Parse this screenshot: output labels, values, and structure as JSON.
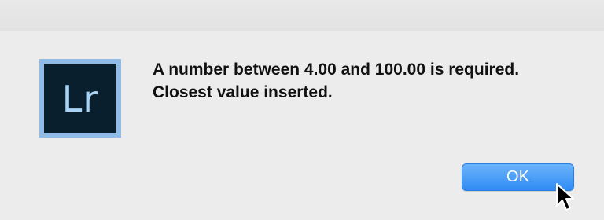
{
  "app_icon": {
    "label": "Lr",
    "icon_name": "lightroom-app-icon",
    "frame_color": "#8fbbe6",
    "background_color": "#0a1f2d",
    "text_color": "#a9d3f5"
  },
  "message": {
    "text": "A number between 4.00 and 100.00 is required. Closest value inserted."
  },
  "buttons": {
    "ok_label": "OK",
    "ok_color": "#3a93f5"
  },
  "cursor": {
    "icon_name": "mouse-pointer-icon"
  }
}
